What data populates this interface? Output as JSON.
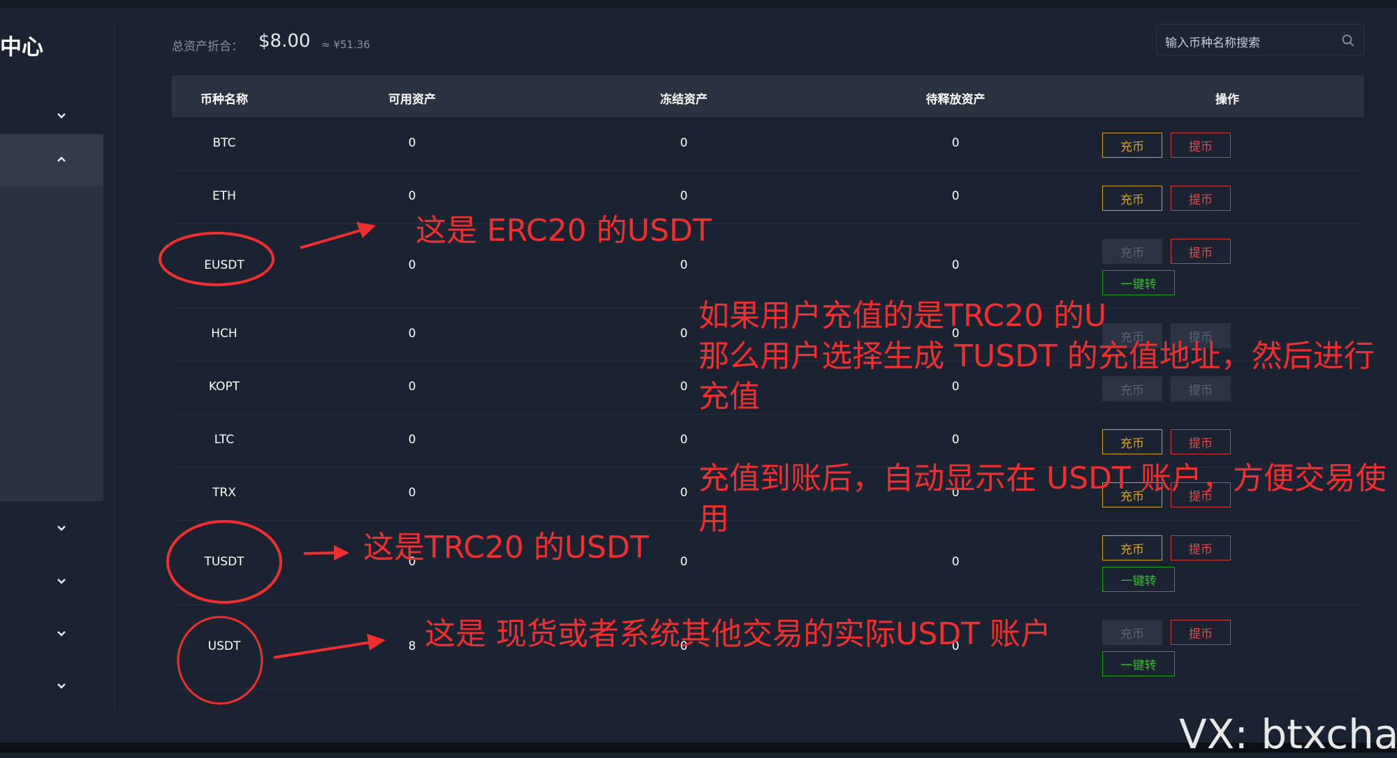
{
  "sidebar": {
    "title": "中心",
    "items": [
      {
        "icon": "chevron-down-icon"
      },
      {
        "icon": "chevron-up-icon",
        "active": true
      },
      {
        "icon": "chevron-down-icon"
      },
      {
        "icon": "chevron-down-icon"
      },
      {
        "icon": "chevron-down-icon"
      },
      {
        "icon": "chevron-down-icon"
      }
    ]
  },
  "header": {
    "total_label": "总资产折合：",
    "total_usd": "$8.00",
    "total_cny": "≈ ¥51.36"
  },
  "search": {
    "placeholder": "输入币种名称搜索",
    "icon": "search-icon"
  },
  "table": {
    "columns": [
      "币种名称",
      "可用资产",
      "冻结资产",
      "待释放资产",
      "操作"
    ],
    "rows": [
      {
        "coin": "BTC",
        "available": "0",
        "frozen": "0",
        "pending": "0",
        "deposit": "充币",
        "withdraw": "提币",
        "deposit_enabled": true,
        "withdraw_enabled": true,
        "transfer": ""
      },
      {
        "coin": "ETH",
        "available": "0",
        "frozen": "0",
        "pending": "0",
        "deposit": "充币",
        "withdraw": "提币",
        "deposit_enabled": true,
        "withdraw_enabled": true,
        "transfer": ""
      },
      {
        "coin": "EUSDT",
        "available": "0",
        "frozen": "0",
        "pending": "0",
        "deposit": "充币",
        "withdraw": "提币",
        "deposit_enabled": false,
        "withdraw_enabled": true,
        "transfer": "一键转"
      },
      {
        "coin": "HCH",
        "available": "0",
        "frozen": "0",
        "pending": "0",
        "deposit": "充币",
        "withdraw": "提币",
        "deposit_enabled": false,
        "withdraw_enabled": false,
        "transfer": ""
      },
      {
        "coin": "KOPT",
        "available": "0",
        "frozen": "0",
        "pending": "0",
        "deposit": "充币",
        "withdraw": "提币",
        "deposit_enabled": false,
        "withdraw_enabled": false,
        "transfer": ""
      },
      {
        "coin": "LTC",
        "available": "0",
        "frozen": "0",
        "pending": "0",
        "deposit": "充币",
        "withdraw": "提币",
        "deposit_enabled": true,
        "withdraw_enabled": true,
        "transfer": ""
      },
      {
        "coin": "TRX",
        "available": "0",
        "frozen": "0",
        "pending": "0",
        "deposit": "充币",
        "withdraw": "提币",
        "deposit_enabled": true,
        "withdraw_enabled": true,
        "transfer": ""
      },
      {
        "coin": "TUSDT",
        "available": "0",
        "frozen": "0",
        "pending": "0",
        "deposit": "充币",
        "withdraw": "提币",
        "deposit_enabled": true,
        "withdraw_enabled": true,
        "transfer": "一键转"
      },
      {
        "coin": "USDT",
        "available": "8",
        "frozen": "0",
        "pending": "0",
        "deposit": "充币",
        "withdraw": "提币",
        "deposit_enabled": false,
        "withdraw_enabled": true,
        "transfer": "一键转"
      }
    ]
  },
  "annotations": {
    "erc20": "这是 ERC20 的USDT",
    "trc20_line1": "如果用户充值的是TRC20 的U",
    "trc20_line2": "那么用户选择生成 TUSDT 的充值地址，然后进行",
    "trc20_line3": "充值",
    "arrival_line1": "充值到账后，自动显示在 USDT 账户，方便交易使",
    "arrival_line2": "用",
    "trc20_usdt": "这是TRC20 的USDT",
    "spot_usdt": "这是 现货或者系统其他交易的实际USDT 账户",
    "color": "#f0302e"
  },
  "watermark": "VX: btxchain",
  "colors": {
    "background": "#1b2231",
    "deposit": "#d6a525",
    "withdraw": "#e24b4b",
    "transfer": "#2fbf2f",
    "disabled": "#5b6474"
  }
}
